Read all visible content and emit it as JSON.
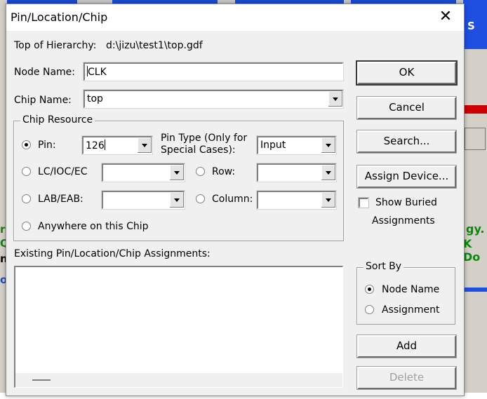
{
  "dialog": {
    "title": "Pin/Location/Chip",
    "hierarchy_label": "Top of Hierarchy:",
    "hierarchy_path": "d:\\jizu\\test1\\top.gdf"
  },
  "node_name": {
    "label": "Node Name:",
    "value": "CLK"
  },
  "chip_name": {
    "label": "Chip Name:",
    "value": "top"
  },
  "chip_resource": {
    "title": "Chip Resource",
    "selected": "Pin",
    "pin": {
      "label": "Pin:",
      "value": "126"
    },
    "pin_type": {
      "label_line1": "Pin Type (Only for",
      "label_line2": "Special Cases):",
      "value": "Input"
    },
    "lc_ioc_ec": {
      "label": "LC/IOC/EC",
      "value": ""
    },
    "row": {
      "label": "Row:",
      "value": ""
    },
    "lab_eab": {
      "label": "LAB/EAB:",
      "value": ""
    },
    "column": {
      "label": "Column:",
      "value": ""
    },
    "anywhere": {
      "label": "Anywhere on this Chip"
    }
  },
  "existing": {
    "label": "Existing Pin/Location/Chip Assignments:",
    "items": []
  },
  "buttons": {
    "ok": "OK",
    "cancel": "Cancel",
    "search": "Search...",
    "assign_device": "Assign Device...",
    "add": "Add",
    "delete": "Delete"
  },
  "show_buried": {
    "line1": "Show Buried",
    "line2": "Assignments",
    "checked": false
  },
  "sort_by": {
    "title": "Sort By",
    "selected": "Node Name",
    "options": [
      "Node Name",
      "Assignment"
    ]
  },
  "background": {
    "right_letter": "S",
    "fragments": [
      "gy.",
      "K Do"
    ],
    "left_letters": [
      "r",
      "Q",
      "n",
      "o"
    ]
  },
  "colors": {
    "dialog_bg": "#f0f0f0",
    "app_blue": "#1c4bd0",
    "text_green": "#0a8a0a"
  }
}
